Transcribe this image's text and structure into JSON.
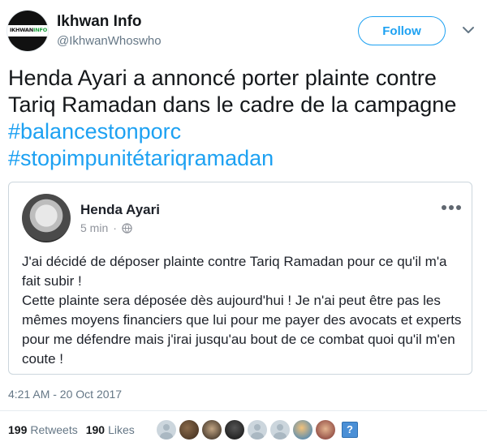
{
  "author": {
    "logo_text_black": "IKHWAN",
    "logo_text_green": "INFO",
    "name": "Ikhwan Info",
    "handle": "@IkhwanWhoswho"
  },
  "follow_label": "Follow",
  "tweet": {
    "text": "Henda Ayari a annoncé porter plainte contre Tariq Ramadan dans le cadre de la campagne ",
    "hashtag1": "#balancestonporc",
    "hashtag2": "#stopimpunitétariqramadan"
  },
  "embedded_post": {
    "name": "Henda Ayari",
    "time": "5 min",
    "separator": "·",
    "body": [
      "J'ai décidé de déposer plainte contre Tariq Ramadan pour ce qu'il m'a fait subir !",
      "Cette plainte sera déposée dès aujourd'hui ! Je n'ai peut être pas les mêmes moyens financiers que lui pour me payer des avocats et experts pour me défendre mais j'irai jusqu'au bout de ce combat quoi qu'il m'en coute !"
    ]
  },
  "timestamp": "4:21 AM - 20 Oct 2017",
  "stats": {
    "retweets_count": "199",
    "retweets_label": "Retweets",
    "likes_count": "190",
    "likes_label": "Likes"
  },
  "likers_question_mark": "?",
  "colors": {
    "link_blue": "#1da1f2",
    "text_dark": "#14171a",
    "text_muted": "#657786"
  }
}
